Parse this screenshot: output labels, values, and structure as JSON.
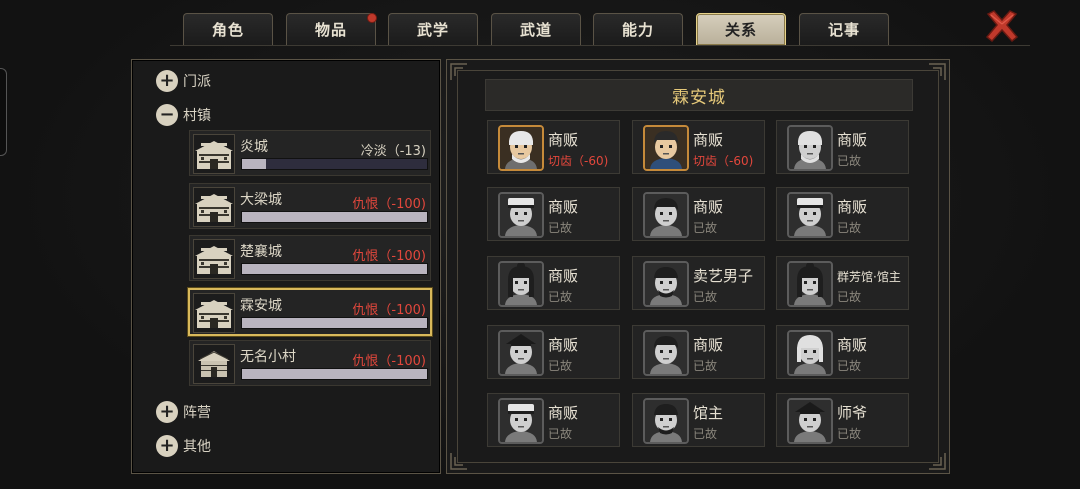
{
  "tabs": [
    {
      "label": "角色",
      "active": false,
      "badge": false
    },
    {
      "label": "物品",
      "active": false,
      "badge": true
    },
    {
      "label": "武学",
      "active": false,
      "badge": false
    },
    {
      "label": "武道",
      "active": false,
      "badge": false
    },
    {
      "label": "能力",
      "active": false,
      "badge": false
    },
    {
      "label": "关系",
      "active": true,
      "badge": false
    },
    {
      "label": "记事",
      "active": false,
      "badge": false
    }
  ],
  "close_icon": "close-x-icon",
  "left": {
    "groups": {
      "sect": {
        "label": "门派",
        "expanded": false
      },
      "village": {
        "label": "村镇",
        "expanded": true
      },
      "camp": {
        "label": "阵营",
        "expanded": false
      },
      "other": {
        "label": "其他",
        "expanded": false
      }
    },
    "towns": [
      {
        "name": "炎城",
        "status": "冷淡（-13)",
        "tone": "cold",
        "level": 0.13,
        "icon": "town-gate-icon",
        "selected": false
      },
      {
        "name": "大梁城",
        "status": "仇恨（-100)",
        "tone": "hate",
        "level": 1.0,
        "icon": "town-gate-icon",
        "selected": false
      },
      {
        "name": "楚襄城",
        "status": "仇恨（-100)",
        "tone": "hate",
        "level": 1.0,
        "icon": "town-gate-icon",
        "selected": false
      },
      {
        "name": "霖安城",
        "status": "仇恨（-100)",
        "tone": "hate",
        "level": 1.0,
        "icon": "town-gate-icon",
        "selected": true
      },
      {
        "name": "无名小村",
        "status": "仇恨（-100)",
        "tone": "hate",
        "level": 1.0,
        "icon": "village-hut-icon",
        "selected": false
      }
    ]
  },
  "right": {
    "title": "霖安城",
    "npcs": [
      {
        "name": "商贩",
        "status": "切齿（-60)",
        "alive": true,
        "look": "old-man"
      },
      {
        "name": "商贩",
        "status": "切齿（-60)",
        "alive": true,
        "look": "young-man"
      },
      {
        "name": "商贩",
        "status": "已故",
        "alive": false,
        "look": "old-man"
      },
      {
        "name": "商贩",
        "status": "已故",
        "alive": false,
        "look": "capped"
      },
      {
        "name": "商贩",
        "status": "已故",
        "alive": false,
        "look": "young-man"
      },
      {
        "name": "商贩",
        "status": "已故",
        "alive": false,
        "look": "capped"
      },
      {
        "name": "商贩",
        "status": "已故",
        "alive": false,
        "look": "woman"
      },
      {
        "name": "卖艺男子",
        "status": "已故",
        "alive": false,
        "look": "bearded"
      },
      {
        "name": "群芳馆·馆主",
        "status": "已故",
        "alive": false,
        "look": "woman"
      },
      {
        "name": "商贩",
        "status": "已故",
        "alive": false,
        "look": "hat"
      },
      {
        "name": "商贩",
        "status": "已故",
        "alive": false,
        "look": "young-man"
      },
      {
        "name": "商贩",
        "status": "已故",
        "alive": false,
        "look": "old-woman"
      },
      {
        "name": "商贩",
        "status": "已故",
        "alive": false,
        "look": "capped"
      },
      {
        "name": "馆主",
        "status": "已故",
        "alive": false,
        "look": "bearded"
      },
      {
        "name": "师爷",
        "status": "已故",
        "alive": false,
        "look": "hat"
      }
    ]
  },
  "colors": {
    "accent_gold": "#d9b95b",
    "hate_red": "#e2473c",
    "close_red": "#c0392b"
  }
}
